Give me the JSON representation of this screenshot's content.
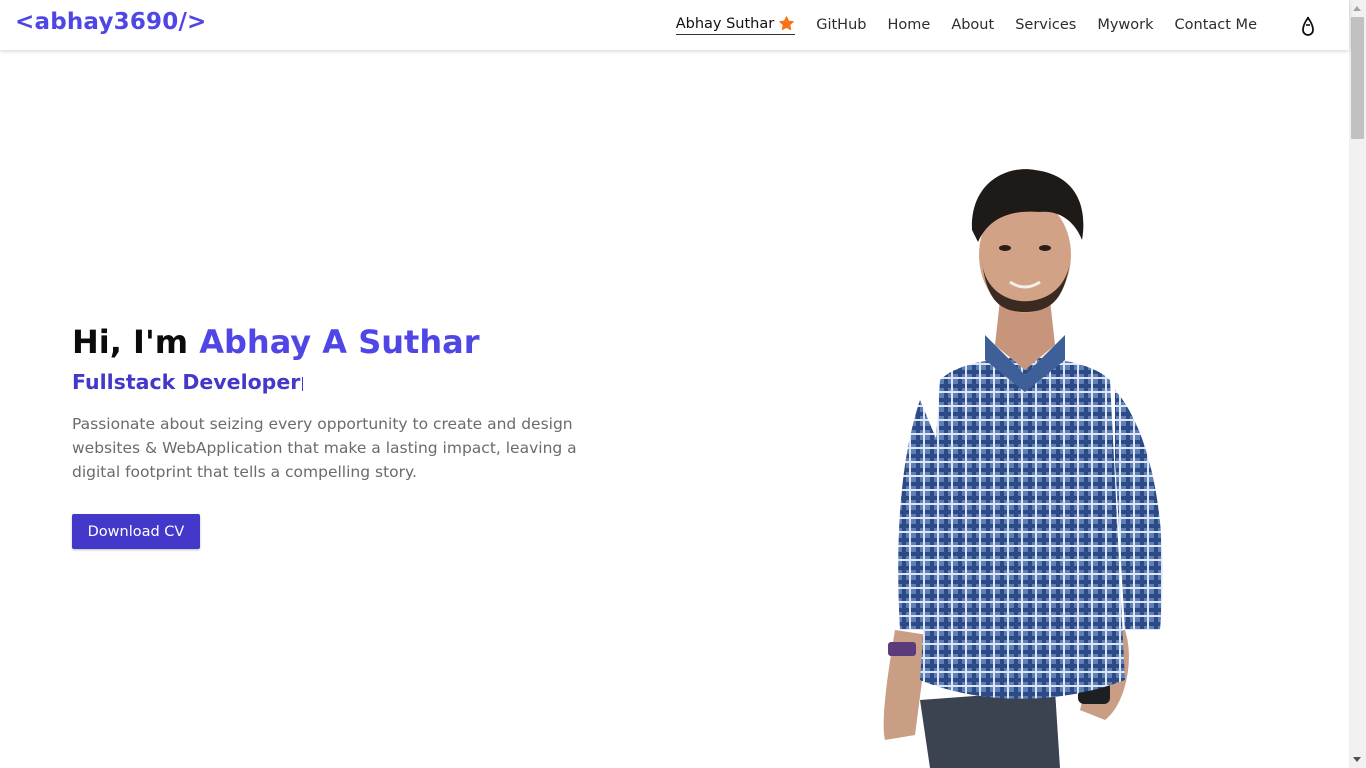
{
  "navbar": {
    "brand": "<abhay3690/>",
    "links": [
      {
        "label": "Abhay Suthar",
        "icon": "star-icon"
      },
      {
        "label": "GitHub"
      },
      {
        "label": "Home"
      },
      {
        "label": "About"
      },
      {
        "label": "Services"
      },
      {
        "label": "Mywork"
      },
      {
        "label": "Contact Me"
      }
    ],
    "theme_toggle_icon": "moon-drop-icon"
  },
  "hero": {
    "greeting": "Hi, I'm",
    "name": "Abhay A Suthar",
    "role": "Fullstack Developer",
    "description": "Passionate about seizing every opportunity to create and design websites & WebApplication that make a lasting impact, leaving a digital footprint that tells a compelling story.",
    "cta_label": "Download CV"
  },
  "colors": {
    "accent": "#4f46e5",
    "button": "#4338ca",
    "star": "#f97316"
  }
}
